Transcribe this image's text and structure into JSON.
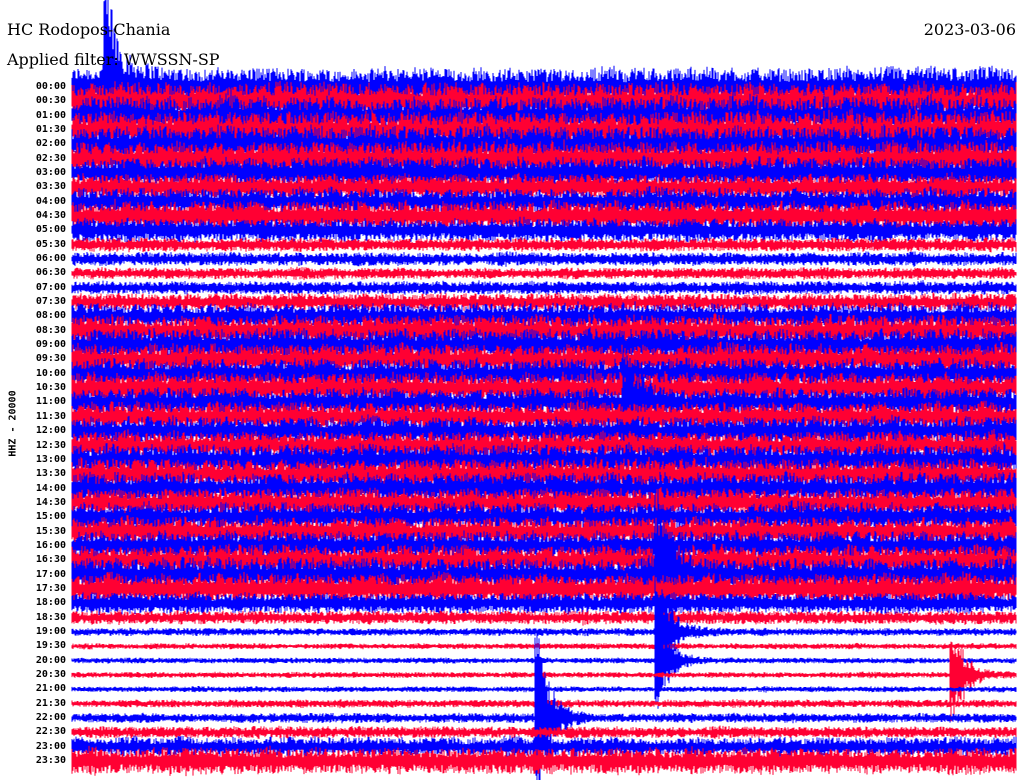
{
  "chart_data": {
    "type": "line",
    "title": "HC Rodopos-Chania",
    "subtitle": "Applied filter: WWSSN-SP",
    "date": "2023-03-06",
    "ylabel": "HHZ - 20000",
    "minutes_per_row": 30,
    "series_colors": [
      "#0000ff",
      "#ff0033"
    ],
    "rows": [
      "00:00",
      "00:30",
      "01:00",
      "01:30",
      "02:00",
      "02:30",
      "03:00",
      "03:30",
      "04:00",
      "04:30",
      "05:00",
      "05:30",
      "06:00",
      "06:30",
      "07:00",
      "07:30",
      "08:00",
      "08:30",
      "09:00",
      "09:30",
      "10:00",
      "10:30",
      "11:00",
      "11:30",
      "12:00",
      "12:30",
      "13:00",
      "13:30",
      "14:00",
      "14:30",
      "15:00",
      "15:30",
      "16:00",
      "16:30",
      "17:00",
      "17:30",
      "18:00",
      "18:30",
      "19:00",
      "19:30",
      "20:00",
      "20:30",
      "21:00",
      "21:30",
      "22:00",
      "22:30",
      "23:00",
      "23:30"
    ],
    "relative_amplitude": [
      1.0,
      1.0,
      1.0,
      1.0,
      0.95,
      0.9,
      0.8,
      0.7,
      0.7,
      0.8,
      0.6,
      0.35,
      0.35,
      0.3,
      0.35,
      0.45,
      0.7,
      0.8,
      0.85,
      0.8,
      0.8,
      0.8,
      0.75,
      0.75,
      0.75,
      0.75,
      0.8,
      0.8,
      0.8,
      0.75,
      0.75,
      0.75,
      0.75,
      0.8,
      0.85,
      0.8,
      0.55,
      0.35,
      0.2,
      0.15,
      0.15,
      0.15,
      0.15,
      0.2,
      0.25,
      0.3,
      0.5,
      0.7
    ],
    "events": [
      {
        "row": "00:00",
        "minute": 1.1,
        "amplitude": 6
      },
      {
        "row": "11:00",
        "minute": 17.6,
        "amplitude": 3
      },
      {
        "row": "17:00",
        "minute": 18.6,
        "amplitude": 5
      },
      {
        "row": "19:00",
        "minute": 18.6,
        "amplitude": 4
      },
      {
        "row": "20:00",
        "minute": 18.6,
        "amplitude": 3
      },
      {
        "row": "22:00",
        "minute": 14.8,
        "amplitude": 5
      },
      {
        "row": "20:30",
        "minute": 28.0,
        "amplitude": 3
      }
    ]
  }
}
